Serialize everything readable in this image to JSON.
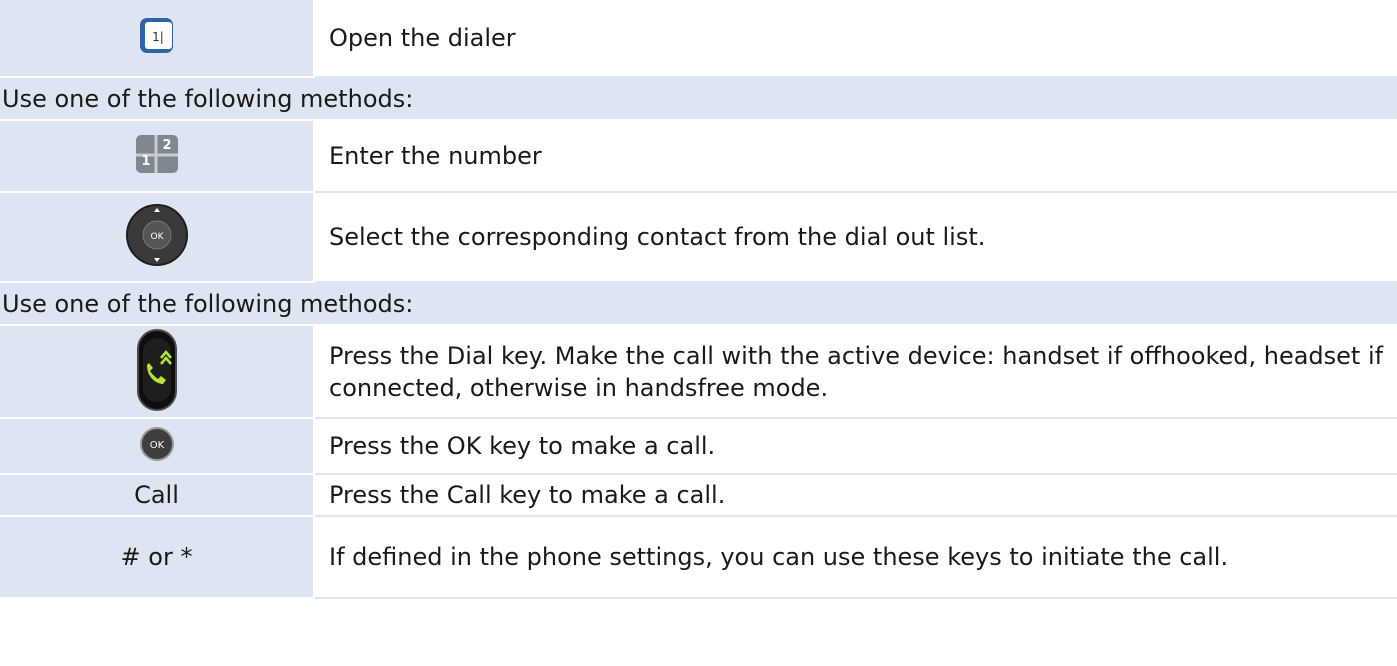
{
  "rows": [
    {
      "icon": "dialer-key-icon",
      "icon_text": "1|",
      "text": "Open the dialer"
    },
    {
      "header": "Use one of the following methods:"
    },
    {
      "icon": "keypad-icon",
      "icon_text": "1 2",
      "text": "Enter the number"
    },
    {
      "icon": "navigator-ok-icon",
      "icon_text": "OK",
      "text": "Select the corresponding contact from the dial out list."
    },
    {
      "header": "Use one of the following methods:"
    },
    {
      "icon": "dial-key-icon",
      "text": "Press the Dial key. Make the call with the active device: handset if offhooked, headset if connected, otherwise in handsfree mode."
    },
    {
      "icon": "ok-key-icon",
      "icon_text": "OK",
      "text": "Press the OK key to make a call."
    },
    {
      "label": "Call",
      "text": "Press the Call key to make a call."
    },
    {
      "label": "# or *",
      "text": "If defined in the phone settings, you can use these keys to initiate the call."
    }
  ],
  "colors": {
    "row_shade": "#dce5f1",
    "dial_green": "#b6e23a"
  }
}
